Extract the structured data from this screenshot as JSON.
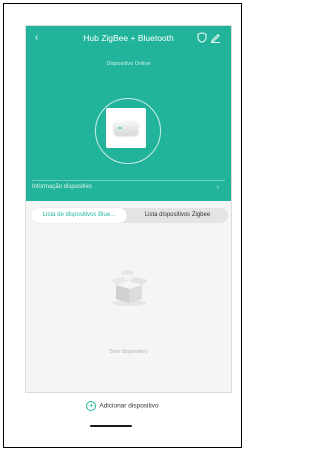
{
  "header": {
    "back_icon": "chevron-left-icon",
    "title": "Hub ZigBee + Bluetooth",
    "shield_icon": "shield-icon",
    "edit_icon": "edit-icon"
  },
  "device": {
    "status": "Dispositivo Online",
    "info_label": "Informação dispositivo",
    "info_chevron": "›"
  },
  "tabs": [
    {
      "label": "Lista de dispositivos Blue...",
      "active": true
    },
    {
      "label": "Lista dispositivos Zigbee",
      "active": false
    }
  ],
  "empty": {
    "text": "Sem dispositivo"
  },
  "footer": {
    "add_icon": "+",
    "add_label": "Adicionar dispositivo"
  },
  "colors": {
    "accent": "#22b49a",
    "background": "#f5f5f5"
  }
}
